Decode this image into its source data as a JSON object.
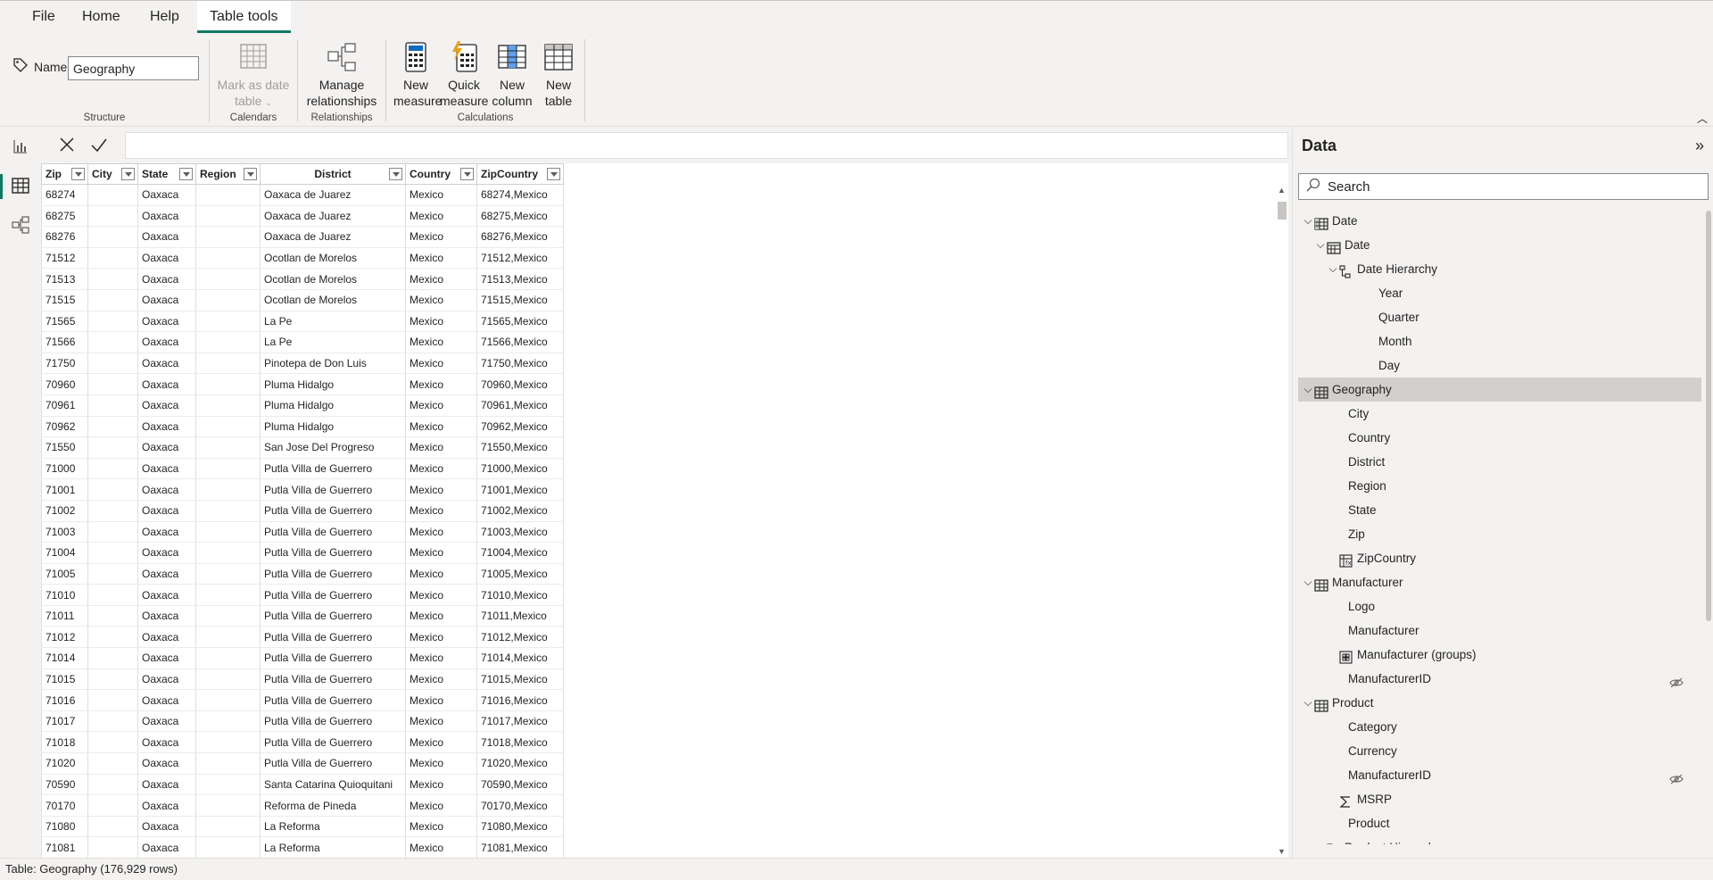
{
  "menu": {
    "file": "File",
    "home": "Home",
    "help": "Help",
    "table_tools": "Table tools",
    "active": "table_tools"
  },
  "ribbon": {
    "name_label": "Name",
    "name_value": "Geography",
    "structure_label": "Structure",
    "mark_date_line1": "Mark as date",
    "mark_date_line2": "table",
    "calendars_label": "Calendars",
    "manage_rel_line1": "Manage",
    "manage_rel_line2": "relationships",
    "relationships_label": "Relationships",
    "new_measure_line1": "New",
    "new_measure_line2": "measure",
    "quick_measure_line1": "Quick",
    "quick_measure_line2": "measure",
    "new_column_line1": "New",
    "new_column_line2": "column",
    "new_table_line1": "New",
    "new_table_line2": "table",
    "calculations_label": "Calculations"
  },
  "grid": {
    "columns": [
      "Zip",
      "City",
      "State",
      "Region",
      "District",
      "Country",
      "ZipCountry"
    ],
    "rows": [
      [
        "68274",
        "",
        "Oaxaca",
        "",
        "Oaxaca de Juarez",
        "Mexico",
        "68274,Mexico"
      ],
      [
        "68275",
        "",
        "Oaxaca",
        "",
        "Oaxaca de Juarez",
        "Mexico",
        "68275,Mexico"
      ],
      [
        "68276",
        "",
        "Oaxaca",
        "",
        "Oaxaca de Juarez",
        "Mexico",
        "68276,Mexico"
      ],
      [
        "71512",
        "",
        "Oaxaca",
        "",
        "Ocotlan de Morelos",
        "Mexico",
        "71512,Mexico"
      ],
      [
        "71513",
        "",
        "Oaxaca",
        "",
        "Ocotlan de Morelos",
        "Mexico",
        "71513,Mexico"
      ],
      [
        "71515",
        "",
        "Oaxaca",
        "",
        "Ocotlan de Morelos",
        "Mexico",
        "71515,Mexico"
      ],
      [
        "71565",
        "",
        "Oaxaca",
        "",
        "La Pe",
        "Mexico",
        "71565,Mexico"
      ],
      [
        "71566",
        "",
        "Oaxaca",
        "",
        "La Pe",
        "Mexico",
        "71566,Mexico"
      ],
      [
        "71750",
        "",
        "Oaxaca",
        "",
        "Pinotepa de Don Luis",
        "Mexico",
        "71750,Mexico"
      ],
      [
        "70960",
        "",
        "Oaxaca",
        "",
        "Pluma Hidalgo",
        "Mexico",
        "70960,Mexico"
      ],
      [
        "70961",
        "",
        "Oaxaca",
        "",
        "Pluma Hidalgo",
        "Mexico",
        "70961,Mexico"
      ],
      [
        "70962",
        "",
        "Oaxaca",
        "",
        "Pluma Hidalgo",
        "Mexico",
        "70962,Mexico"
      ],
      [
        "71550",
        "",
        "Oaxaca",
        "",
        "San Jose Del Progreso",
        "Mexico",
        "71550,Mexico"
      ],
      [
        "71000",
        "",
        "Oaxaca",
        "",
        "Putla Villa de Guerrero",
        "Mexico",
        "71000,Mexico"
      ],
      [
        "71001",
        "",
        "Oaxaca",
        "",
        "Putla Villa de Guerrero",
        "Mexico",
        "71001,Mexico"
      ],
      [
        "71002",
        "",
        "Oaxaca",
        "",
        "Putla Villa de Guerrero",
        "Mexico",
        "71002,Mexico"
      ],
      [
        "71003",
        "",
        "Oaxaca",
        "",
        "Putla Villa de Guerrero",
        "Mexico",
        "71003,Mexico"
      ],
      [
        "71004",
        "",
        "Oaxaca",
        "",
        "Putla Villa de Guerrero",
        "Mexico",
        "71004,Mexico"
      ],
      [
        "71005",
        "",
        "Oaxaca",
        "",
        "Putla Villa de Guerrero",
        "Mexico",
        "71005,Mexico"
      ],
      [
        "71010",
        "",
        "Oaxaca",
        "",
        "Putla Villa de Guerrero",
        "Mexico",
        "71010,Mexico"
      ],
      [
        "71011",
        "",
        "Oaxaca",
        "",
        "Putla Villa de Guerrero",
        "Mexico",
        "71011,Mexico"
      ],
      [
        "71012",
        "",
        "Oaxaca",
        "",
        "Putla Villa de Guerrero",
        "Mexico",
        "71012,Mexico"
      ],
      [
        "71014",
        "",
        "Oaxaca",
        "",
        "Putla Villa de Guerrero",
        "Mexico",
        "71014,Mexico"
      ],
      [
        "71015",
        "",
        "Oaxaca",
        "",
        "Putla Villa de Guerrero",
        "Mexico",
        "71015,Mexico"
      ],
      [
        "71016",
        "",
        "Oaxaca",
        "",
        "Putla Villa de Guerrero",
        "Mexico",
        "71016,Mexico"
      ],
      [
        "71017",
        "",
        "Oaxaca",
        "",
        "Putla Villa de Guerrero",
        "Mexico",
        "71017,Mexico"
      ],
      [
        "71018",
        "",
        "Oaxaca",
        "",
        "Putla Villa de Guerrero",
        "Mexico",
        "71018,Mexico"
      ],
      [
        "71020",
        "",
        "Oaxaca",
        "",
        "Putla Villa de Guerrero",
        "Mexico",
        "71020,Mexico"
      ],
      [
        "70590",
        "",
        "Oaxaca",
        "",
        "Santa Catarina Quioquitani",
        "Mexico",
        "70590,Mexico"
      ],
      [
        "70170",
        "",
        "Oaxaca",
        "",
        "Reforma de Pineda",
        "Mexico",
        "70170,Mexico"
      ],
      [
        "71080",
        "",
        "Oaxaca",
        "",
        "La Reforma",
        "Mexico",
        "71080,Mexico"
      ],
      [
        "71081",
        "",
        "Oaxaca",
        "",
        "La Reforma",
        "Mexico",
        "71081,Mexico"
      ]
    ]
  },
  "data_pane": {
    "title": "Data",
    "search_placeholder": "Search",
    "tree": [
      {
        "label": "Date",
        "level": 0,
        "chev": "open",
        "icon": "table-calc-icon"
      },
      {
        "label": "Date",
        "level": 1,
        "chev": "open",
        "icon": "calendar-icon"
      },
      {
        "label": "Date Hierarchy",
        "level": 2,
        "chev": "open",
        "icon": "hierarchy-icon"
      },
      {
        "label": "Year",
        "level": 4,
        "chev": "",
        "icon": ""
      },
      {
        "label": "Quarter",
        "level": 4,
        "chev": "",
        "icon": ""
      },
      {
        "label": "Month",
        "level": 4,
        "chev": "",
        "icon": ""
      },
      {
        "label": "Day",
        "level": 4,
        "chev": "",
        "icon": ""
      },
      {
        "label": "Geography",
        "level": 0,
        "chev": "open",
        "icon": "table-icon",
        "selected": true
      },
      {
        "label": "City",
        "level": 2,
        "chev": "",
        "icon": ""
      },
      {
        "label": "Country",
        "level": 2,
        "chev": "",
        "icon": ""
      },
      {
        "label": "District",
        "level": 2,
        "chev": "",
        "icon": ""
      },
      {
        "label": "Region",
        "level": 2,
        "chev": "",
        "icon": ""
      },
      {
        "label": "State",
        "level": 2,
        "chev": "",
        "icon": ""
      },
      {
        "label": "Zip",
        "level": 2,
        "chev": "",
        "icon": ""
      },
      {
        "label": "ZipCountry",
        "level": 2,
        "chev": "",
        "icon": "calc-column-icon"
      },
      {
        "label": "Manufacturer",
        "level": 0,
        "chev": "open",
        "icon": "table-icon"
      },
      {
        "label": "Logo",
        "level": 2,
        "chev": "",
        "icon": ""
      },
      {
        "label": "Manufacturer",
        "level": 2,
        "chev": "",
        "icon": ""
      },
      {
        "label": "Manufacturer (groups)",
        "level": 2,
        "chev": "",
        "icon": "group-icon"
      },
      {
        "label": "ManufacturerID",
        "level": 2,
        "chev": "",
        "icon": "",
        "hidden": true
      },
      {
        "label": "Product",
        "level": 0,
        "chev": "open",
        "icon": "table-icon"
      },
      {
        "label": "Category",
        "level": 2,
        "chev": "",
        "icon": ""
      },
      {
        "label": "Currency",
        "level": 2,
        "chev": "",
        "icon": ""
      },
      {
        "label": "ManufacturerID",
        "level": 2,
        "chev": "",
        "icon": "",
        "hidden": true
      },
      {
        "label": "MSRP",
        "level": 2,
        "chev": "",
        "icon": "sigma-icon"
      },
      {
        "label": "Product",
        "level": 2,
        "chev": "",
        "icon": ""
      },
      {
        "label": "Product Hierarchy",
        "level": 1,
        "chev": "open",
        "icon": "hierarchy-icon"
      }
    ]
  },
  "status": {
    "text": "Table: Geography (176,929 rows)"
  },
  "colors": {
    "accent": "#117865",
    "background": "#f3f2f1",
    "selected_row": "#d2d0ce"
  }
}
